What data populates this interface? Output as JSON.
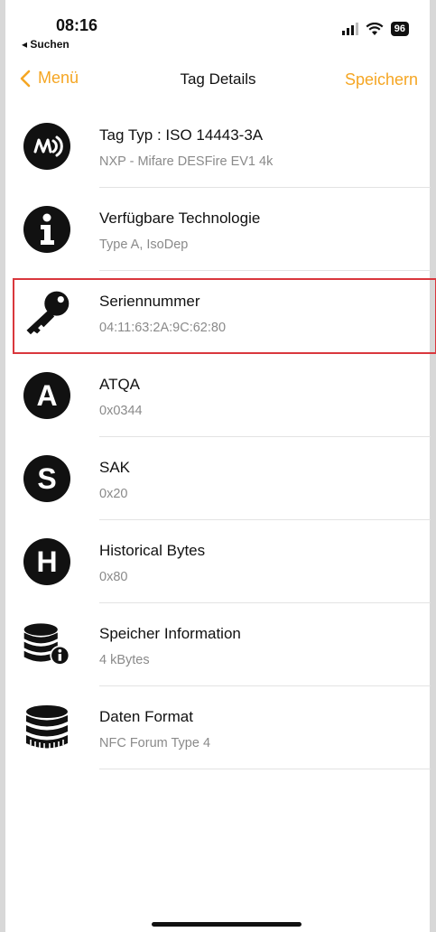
{
  "status_bar": {
    "time": "08:16",
    "back_app": "◂ Suchen",
    "battery": "96"
  },
  "nav": {
    "back_label": "Menü",
    "title": "Tag Details",
    "save_label": "Speichern"
  },
  "rows": [
    {
      "title": "Tag Typ : ISO 14443-3A",
      "subtitle": "NXP - Mifare DESFire EV1 4k",
      "icon": "nfc-icon"
    },
    {
      "title": "Verfügbare Technologie",
      "subtitle": "Type A, IsoDep",
      "icon": "info-icon"
    },
    {
      "title": "Seriennummer",
      "subtitle": "04:11:63:2A:9C:62:80",
      "icon": "key-icon"
    },
    {
      "title": "ATQA",
      "subtitle": "0x0344",
      "icon": "letter-a-icon",
      "letter": "A"
    },
    {
      "title": "SAK",
      "subtitle": "0x20",
      "icon": "letter-s-icon",
      "letter": "S"
    },
    {
      "title": "Historical Bytes",
      "subtitle": "0x80",
      "icon": "letter-h-icon",
      "letter": "H"
    },
    {
      "title": "Speicher Information",
      "subtitle": "4 kBytes",
      "icon": "database-info-icon"
    },
    {
      "title": "Daten Format",
      "subtitle": "NFC Forum Type 4",
      "icon": "coin-stack-icon"
    }
  ],
  "colors": {
    "accent": "#f5a623",
    "highlight": "#d9373d",
    "subtitle": "#8a8a8a"
  }
}
